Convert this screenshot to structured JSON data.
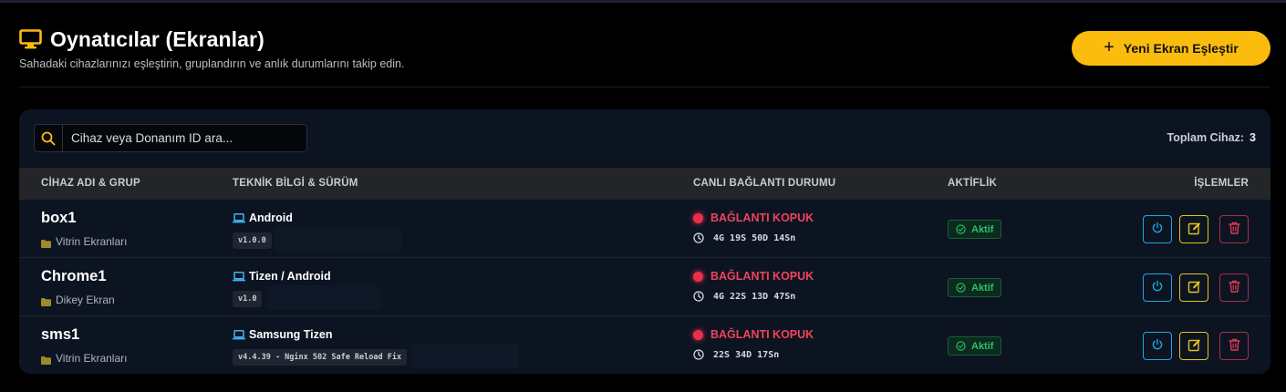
{
  "header": {
    "title": "Oynatıcılar (Ekranlar)",
    "subtitle": "Sahadaki cihazlarınızı eşleştirin, gruplandırın ve anlık durumlarını takip edin.",
    "pair_button": "Yeni Ekran Eşleştir",
    "pair_button_icon": "plus-icon",
    "title_icon": "monitor-icon"
  },
  "toolbar": {
    "search_placeholder": "Cihaz veya Donanım ID ara...",
    "search_value": "",
    "total_label": "Toplam Cihaz:",
    "total_count": "3"
  },
  "table": {
    "headers": {
      "device": "CİHAZ ADI & GRUP",
      "tech": "TEKNİK BİLGİ & SÜRÜM",
      "status": "CANLI BAĞLANTI DURUMU",
      "active": "AKTİFLİK",
      "actions": "İŞLEMLER"
    },
    "rows": [
      {
        "name": "box1",
        "group": "Vitrin Ekranları",
        "platform": "Android",
        "version": "v1.0.0",
        "status": "BAĞLANTI KOPUK",
        "uptime": "4G 19S 50D 14Sn",
        "active": "Aktif"
      },
      {
        "name": "Chrome1",
        "group": "Dikey Ekran",
        "platform": "Tizen / Android",
        "version": "v1.0",
        "status": "BAĞLANTI KOPUK",
        "uptime": "4G 22S 13D 47Sn",
        "active": "Aktif"
      },
      {
        "name": "sms1",
        "group": "Vitrin Ekranları",
        "platform": "Samsung Tizen",
        "version": "v4.4.39 - Nginx 502 Safe Reload Fix",
        "status": "BAĞLANTI KOPUK",
        "uptime": "22S 34D 17Sn",
        "active": "Aktif"
      }
    ]
  },
  "colors": {
    "accent": "#fbbc0e",
    "disconnected": "#f0435a",
    "active": "#27c468",
    "power": "#1ea6e0",
    "edit": "#e6c31a",
    "delete": "#e03a52",
    "platform_icon": "#3fb4f0"
  }
}
